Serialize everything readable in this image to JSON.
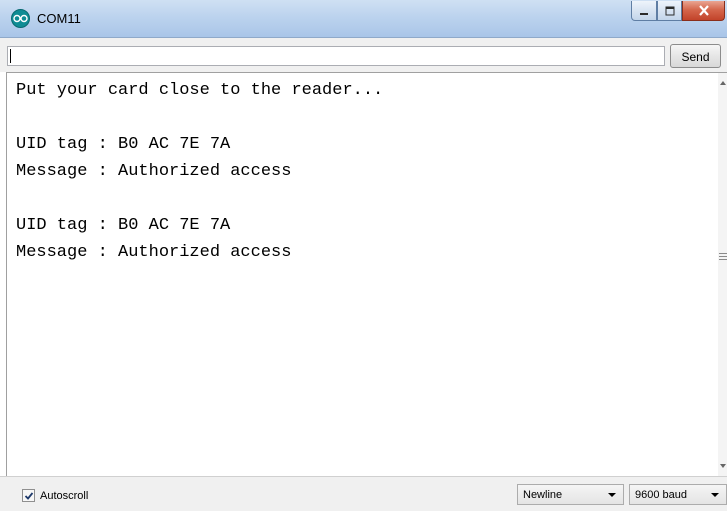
{
  "window": {
    "title": "COM11",
    "app_icon": "arduino-infinity-icon",
    "controls": [
      "minimize",
      "maximize",
      "close"
    ]
  },
  "input_row": {
    "value": "",
    "send_label": "Send"
  },
  "output": {
    "lines": [
      "Put your card close to the reader...",
      "",
      "UID tag : B0 AC 7E 7A",
      "Message : Authorized access",
      "",
      "UID tag : B0 AC 7E 7A",
      "Message : Authorized access"
    ]
  },
  "bottom_bar": {
    "autoscroll_label": "Autoscroll",
    "autoscroll_checked": true,
    "line_ending": "Newline",
    "baud_rate": "9600 baud"
  },
  "colors": {
    "titlebar": "#bcd3ee",
    "close_button": "#c94f35",
    "app_icon": "#0f8c94"
  }
}
